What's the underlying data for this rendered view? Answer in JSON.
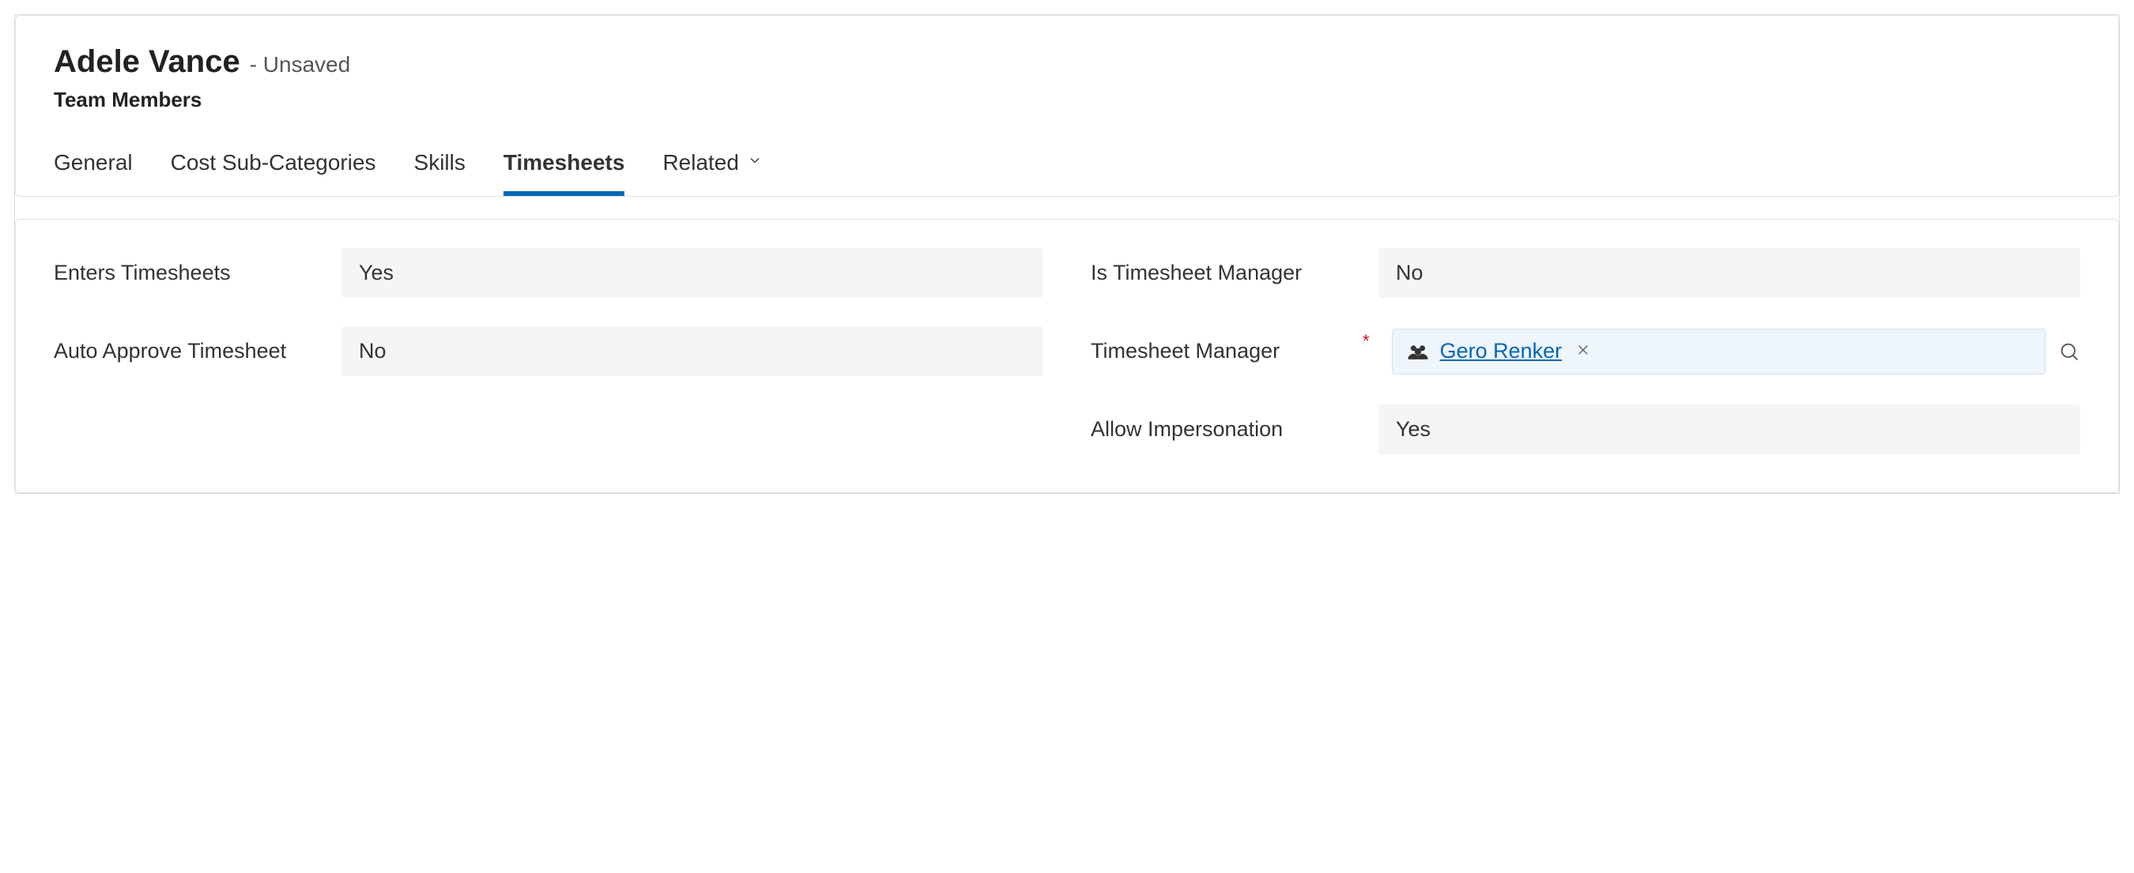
{
  "header": {
    "title": "Adele Vance",
    "status_prefix": "-",
    "status": "Unsaved",
    "subtitle": "Team Members"
  },
  "tabs": [
    {
      "label": "General",
      "active": false
    },
    {
      "label": "Cost Sub-Categories",
      "active": false
    },
    {
      "label": "Skills",
      "active": false
    },
    {
      "label": "Timesheets",
      "active": true
    },
    {
      "label": "Related",
      "active": false,
      "dropdown": true
    }
  ],
  "fields": {
    "enters_timesheets": {
      "label": "Enters Timesheets",
      "value": "Yes"
    },
    "is_timesheet_manager": {
      "label": "Is Timesheet Manager",
      "value": "No"
    },
    "auto_approve_timesheet": {
      "label": "Auto Approve Timesheet",
      "value": "No"
    },
    "timesheet_manager": {
      "label": "Timesheet Manager",
      "value": "Gero Renker",
      "required": true
    },
    "allow_impersonation": {
      "label": "Allow Impersonation",
      "value": "Yes"
    }
  }
}
